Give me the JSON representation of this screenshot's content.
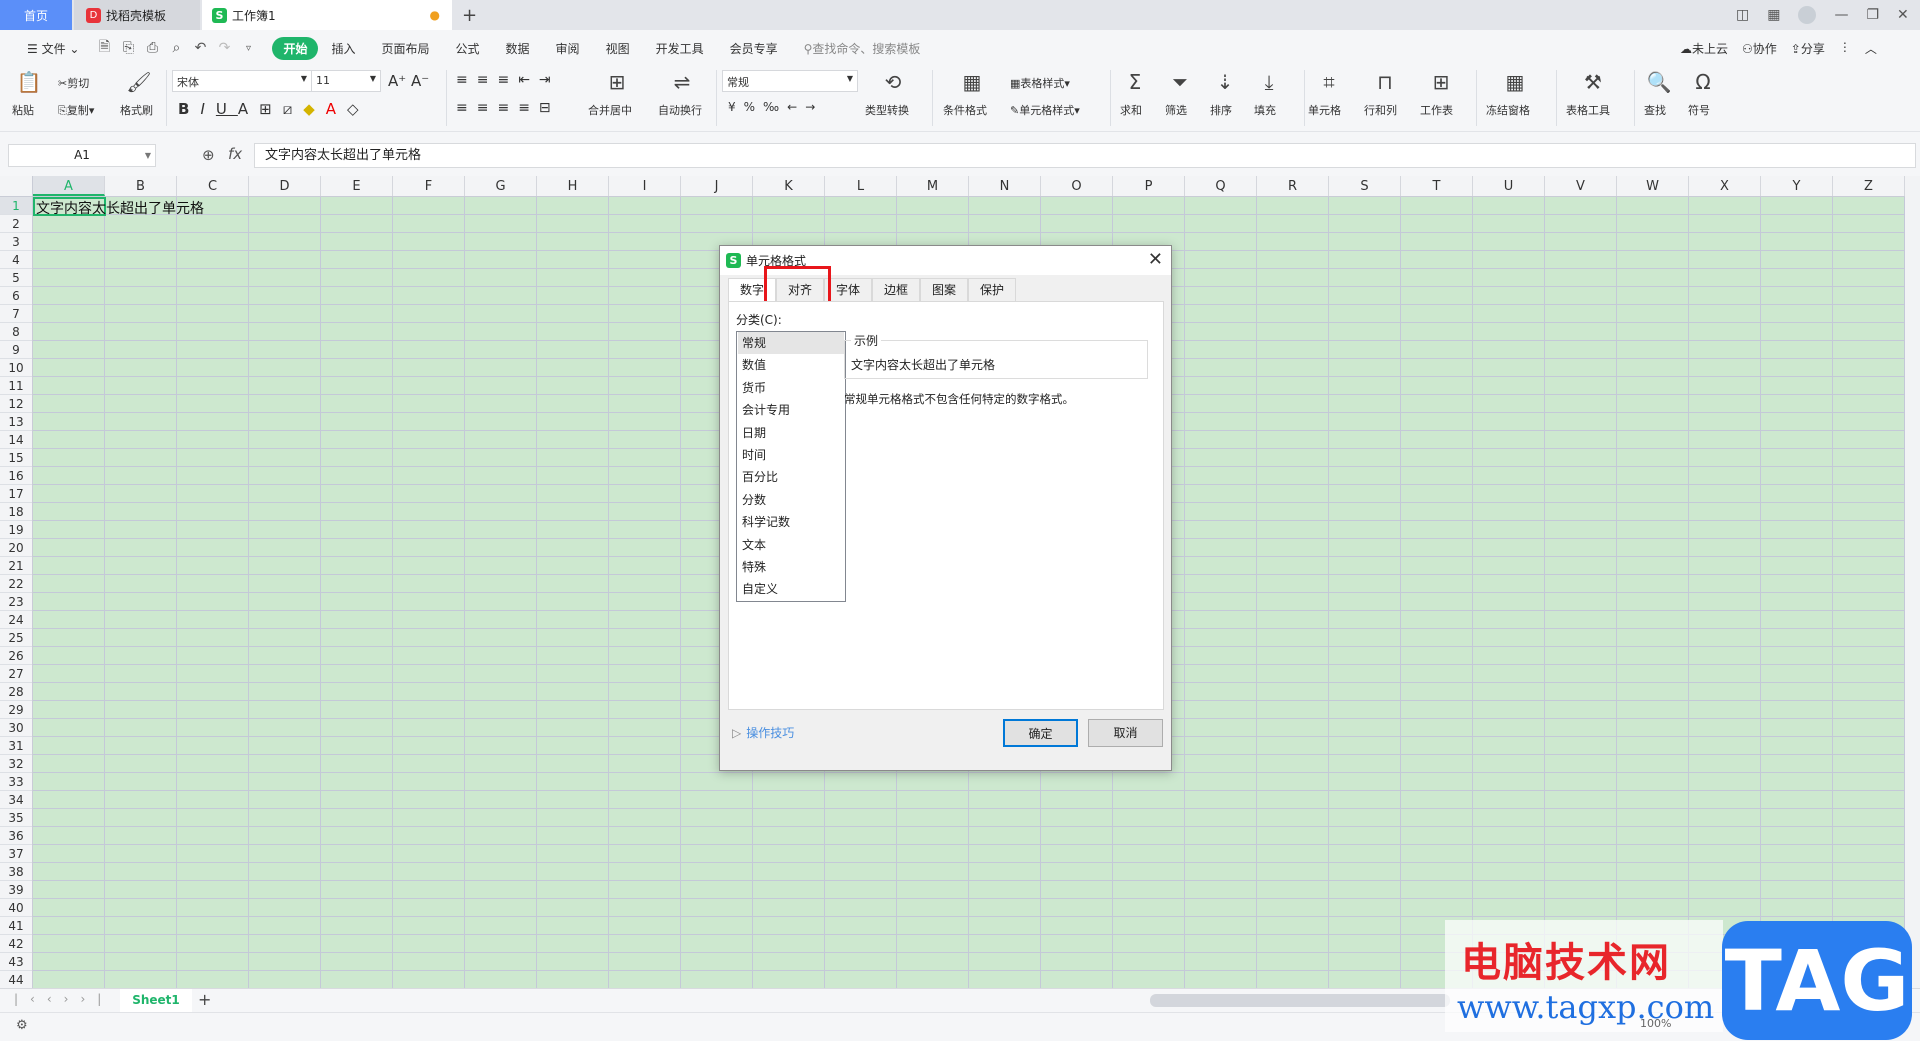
{
  "tabs": {
    "home": "首页",
    "templates": "找稻壳模板",
    "workbook": "工作簿1",
    "new": "+"
  },
  "menu": {
    "file": "文件",
    "items": [
      "开始",
      "插入",
      "页面布局",
      "公式",
      "数据",
      "审阅",
      "视图",
      "开发工具",
      "会员专享"
    ],
    "search": "查找命令、搜索模板",
    "cloud": "未上云",
    "collab": "协作",
    "share": "分享"
  },
  "ribbon": {
    "paste": "粘贴",
    "cut": "剪切",
    "copy": "复制",
    "format_painter": "格式刷",
    "font_name": "宋体",
    "font_size": "11",
    "merge": "合并居中",
    "wrap": "自动换行",
    "number_format": "常规",
    "convert": "类型转换",
    "cond_format": "条件格式",
    "table_style": "表格样式",
    "cell_style": "单元格样式",
    "sum": "求和",
    "filter": "筛选",
    "sort": "排序",
    "fill": "填充",
    "cell": "单元格",
    "rowcol": "行和列",
    "sheet": "工作表",
    "freeze": "冻结窗格",
    "table_tools": "表格工具",
    "find": "查找",
    "symbol": "符号"
  },
  "formula": {
    "name_box": "A1",
    "fx": "fx",
    "value": "文字内容太长超出了单元格"
  },
  "grid": {
    "columns": [
      "A",
      "B",
      "C",
      "D",
      "E",
      "F",
      "G",
      "H",
      "I",
      "J",
      "K",
      "L",
      "M",
      "N",
      "O",
      "P",
      "Q",
      "R",
      "S",
      "T",
      "U",
      "V",
      "W",
      "X",
      "Y",
      "Z"
    ],
    "row_count": 44,
    "a1": "文字内容太长超出了单元格"
  },
  "sheets": {
    "active": "Sheet1",
    "add": "+"
  },
  "status": {
    "zoom": "100%"
  },
  "dialog": {
    "title": "单元格格式",
    "tabs": [
      "数字",
      "对齐",
      "字体",
      "边框",
      "图案",
      "保护"
    ],
    "category_label": "分类(C):",
    "categories": [
      "常规",
      "数值",
      "货币",
      "会计专用",
      "日期",
      "时间",
      "百分比",
      "分数",
      "科学记数",
      "文本",
      "特殊",
      "自定义"
    ],
    "sample_label": "示例",
    "sample_value": "文字内容太长超出了单元格",
    "description": "常规单元格格式不包含任何特定的数字格式。",
    "tips": "操作技巧",
    "ok": "确定",
    "cancel": "取消"
  },
  "watermark": {
    "cn": "电脑技术网",
    "url": "www.tagxp.com",
    "logo": "TAG"
  },
  "colors": {
    "accent": "#1fb56b",
    "cell_bg": "#cde8cf",
    "highlight": "#e8161b"
  }
}
